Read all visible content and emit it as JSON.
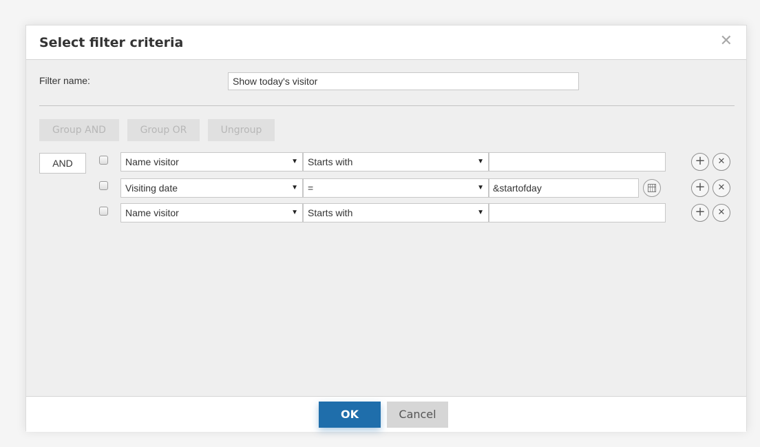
{
  "dialog": {
    "title": "Select filter criteria",
    "close_icon": "close-icon"
  },
  "filter_name": {
    "label": "Filter name:",
    "value": "Show today's visitor"
  },
  "group_buttons": {
    "group_and": "Group AND",
    "group_or": "Group OR",
    "ungroup": "Ungroup"
  },
  "logic_operator": "AND",
  "criteria_rows": [
    {
      "field": "Name visitor",
      "operator": "Starts with",
      "value": "",
      "has_calendar": false
    },
    {
      "field": "Visiting date",
      "operator": "=",
      "value": "&startofday",
      "has_calendar": true
    },
    {
      "field": "Name visitor",
      "operator": "Starts with",
      "value": "",
      "has_calendar": false
    }
  ],
  "row_icons": {
    "add": "plus-icon",
    "remove": "times-icon",
    "calendar": "calendar-icon",
    "dropdown": "chevron-down-icon"
  },
  "glyphs": {
    "close": "✕",
    "dropdown": "▼",
    "add": "+",
    "remove": "✕"
  },
  "footer": {
    "ok_label": "OK",
    "cancel_label": "Cancel"
  },
  "colors": {
    "ok_button": "#1f6eab",
    "cancel_button": "#d6d6d6",
    "dialog_body": "#efefef"
  }
}
